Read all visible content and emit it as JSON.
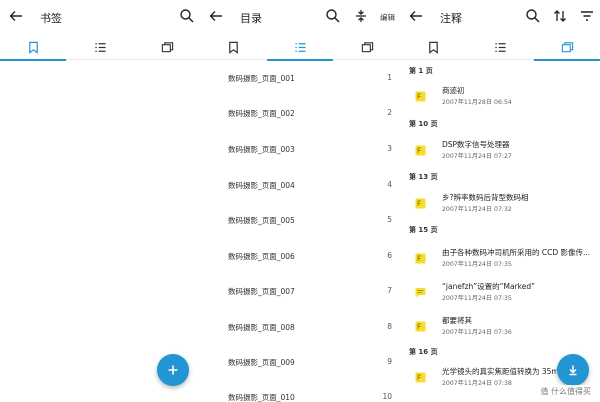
{
  "accent": "#2196d3",
  "bookmarks": {
    "title": "书签",
    "icons": {
      "back": "arrow-left-icon",
      "search": "search-icon"
    }
  },
  "toc": {
    "title": "目录",
    "edit_label": "编辑",
    "items": [
      {
        "label": "数码摄影_页面_001",
        "page": "1"
      },
      {
        "label": "数码摄影_页面_002",
        "page": "2"
      },
      {
        "label": "数码摄影_页面_003",
        "page": "3"
      },
      {
        "label": "数码摄影_页面_004",
        "page": "4"
      },
      {
        "label": "数码摄影_页面_005",
        "page": "5"
      },
      {
        "label": "数码摄影_页面_006",
        "page": "6"
      },
      {
        "label": "数码摄影_页面_007",
        "page": "7"
      },
      {
        "label": "数码摄影_页面_008",
        "page": "8"
      },
      {
        "label": "数码摄影_页面_009",
        "page": "9"
      },
      {
        "label": "数码摄影_页面_010",
        "page": "10"
      }
    ]
  },
  "notes": {
    "title": "注释",
    "groups": [
      {
        "page": "第 1 页",
        "items": [
          {
            "text": "商迹初",
            "date": "2007年11月28日 06:54",
            "icon": "highlight"
          }
        ]
      },
      {
        "page": "第 10 页",
        "items": [
          {
            "text": "DSP数字信号处理器",
            "date": "2007年11月24日 07:27",
            "icon": "highlight"
          }
        ]
      },
      {
        "page": "第 13 页",
        "items": [
          {
            "text": "乡?辨率数码后背型数码相",
            "date": "2007年11月24日 07:32",
            "icon": "highlight"
          }
        ]
      },
      {
        "page": "第 15 页",
        "items": [
          {
            "text": "由子各种数码冲司机所采用的 CCD 影像传...",
            "date": "2007年11月24日 07:35",
            "icon": "highlight"
          },
          {
            "text": "“janefzh”设置的“Marked”",
            "date": "2007年11月24日 07:35",
            "icon": "comment"
          },
          {
            "text": "都要将其",
            "date": "2007年11月24日 07:36",
            "icon": "highlight"
          }
        ]
      },
      {
        "page": "第 16 页",
        "items": [
          {
            "text": "光学镜头的真实焦距值转换为 35mm",
            "date": "2007年11月24日 07:38",
            "icon": "highlight"
          }
        ]
      }
    ]
  },
  "watermark": "值 什么值得买"
}
